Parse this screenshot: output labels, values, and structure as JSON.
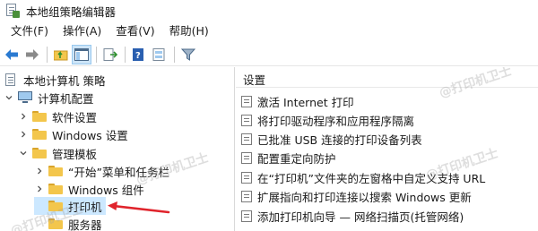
{
  "window": {
    "title": "本地组策略编辑器"
  },
  "menu": {
    "items": [
      "文件(F)",
      "操作(A)",
      "查看(V)",
      "帮助(H)"
    ]
  },
  "toolbar": {
    "buttons": [
      "back-arrow-icon",
      "forward-arrow-icon",
      "folder-up-icon",
      "show-tree-icon",
      "export-list-icon",
      "help-icon",
      "properties-icon",
      "filter-icon"
    ]
  },
  "tree": {
    "root": "本地计算机 策略",
    "computer_config": "计算机配置",
    "software_settings": "软件设置",
    "windows_settings": "Windows 设置",
    "admin_templates": "管理模板",
    "start_menu": "“开始”菜单和任务栏",
    "windows_components": "Windows 组件",
    "printers": "打印机",
    "servers": "服务器"
  },
  "list": {
    "header": "设置",
    "items": [
      "激活 Internet 打印",
      "将打印驱动程序和应用程序隔离",
      "已批准 USB 连接的打印设备列表",
      "配置重定向防护",
      "在“打印机”文件夹的左窗格中自定义支持 URL",
      "扩展指向和打印连接以搜索 Windows 更新",
      "添加打印机向导 — 网络扫描页(托管网络)"
    ]
  },
  "watermark": {
    "text": "@打印机卫士"
  },
  "colors": {
    "selection": "#cce8ff",
    "annotation_arrow": "#e0242c",
    "folder": "#f3c64c"
  }
}
